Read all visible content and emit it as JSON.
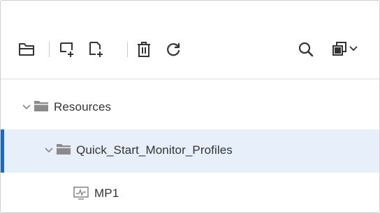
{
  "toolbar": {
    "buttons": [
      {
        "name": "new-folder",
        "icon": "folder-outline-icon"
      },
      {
        "name": "new-node",
        "icon": "new-node-icon"
      },
      {
        "name": "new-item",
        "icon": "new-document-icon"
      },
      {
        "name": "delete",
        "icon": "trash-icon"
      },
      {
        "name": "refresh",
        "icon": "refresh-icon"
      },
      {
        "name": "search",
        "icon": "search-icon"
      },
      {
        "name": "view-options",
        "icon": "copy-dropdown-icon"
      }
    ]
  },
  "tree": {
    "items": [
      {
        "label": "Resources",
        "type": "folder",
        "expanded": true,
        "selected": false,
        "level": 0
      },
      {
        "label": "Quick_Start_Monitor_Profiles",
        "type": "folder",
        "expanded": true,
        "selected": true,
        "level": 1
      },
      {
        "label": "MP1",
        "type": "monitor-profile",
        "selected": false,
        "level": 2
      }
    ]
  },
  "colors": {
    "selection_background": "#e6effa",
    "selection_accent": "#0a6fd6",
    "icon_stroke": "#333333",
    "folder_icon": "#8a8a8a"
  }
}
